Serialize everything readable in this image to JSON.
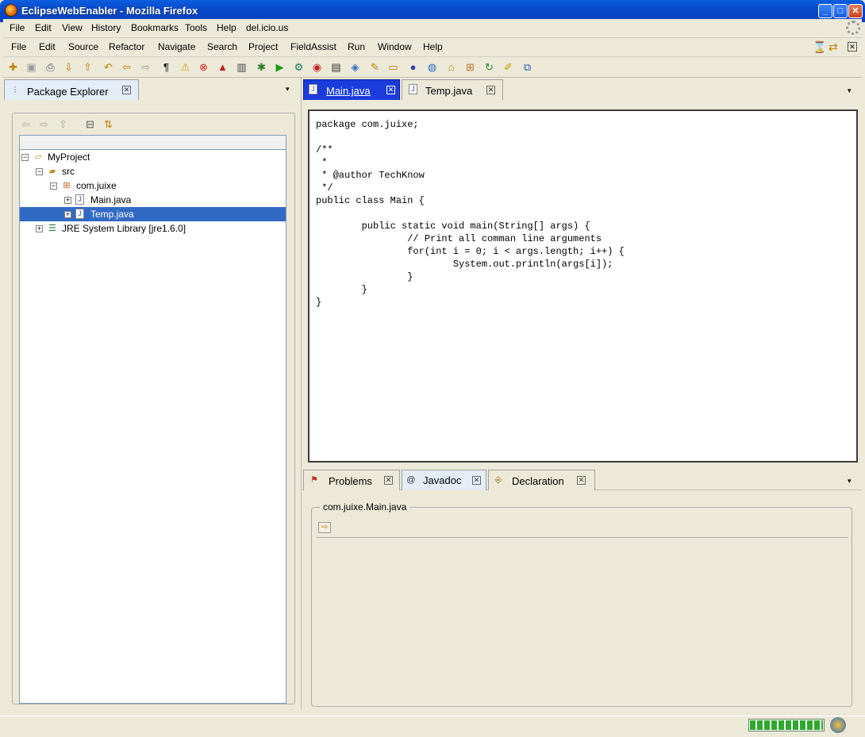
{
  "window": {
    "title": "EclipseWebEnabler - Mozilla Firefox"
  },
  "firefox_menu": [
    "File",
    "Edit",
    "View",
    "History",
    "Bookmarks",
    "Tools",
    "Help",
    "del.icio.us"
  ],
  "eclipse_menu": [
    "File",
    "Edit",
    "Source",
    "Refactor",
    "Navigate",
    "Search",
    "Project",
    "FieldAssist",
    "Run",
    "Window",
    "Help"
  ],
  "left_panel": {
    "tab_label": "Package Explorer",
    "tree": [
      {
        "label": "MyProject"
      },
      {
        "label": "src"
      },
      {
        "label": "com.juixe"
      },
      {
        "label": "Main.java"
      },
      {
        "label": "Temp.java",
        "selected": true
      },
      {
        "label": "JRE System Library [jre1.6.0]"
      }
    ]
  },
  "editor": {
    "tabs": [
      {
        "label": "Main.java",
        "active": true
      },
      {
        "label": "Temp.java"
      }
    ],
    "code": "package com.juixe;\n\n/**\n *\n * @author TechKnow\n */\npublic class Main {\n\n        public static void main(String[] args) {\n                // Print all comman line arguments\n                for(int i = 0; i < args.length; i++) {\n                        System.out.println(args[i]);\n                }\n        }\n}"
  },
  "bottom_panel": {
    "tabs": [
      {
        "label": "Problems"
      },
      {
        "label": "Javadoc",
        "active": true
      },
      {
        "label": "Declaration"
      }
    ],
    "javadoc_title": "com.juixe.Main.java"
  },
  "status": {
    "progress_fraction": 1.0
  }
}
